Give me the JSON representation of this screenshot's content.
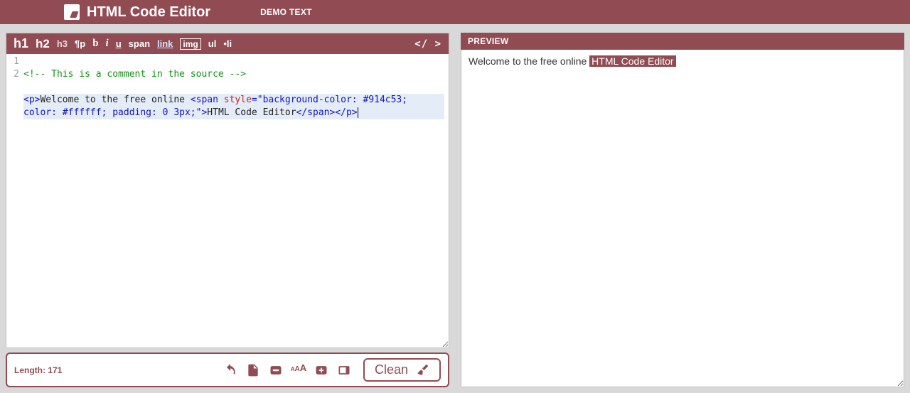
{
  "header": {
    "title": "HTML Code Editor",
    "demo_link": "DEMO TEXT"
  },
  "toolbar": {
    "h1": "h1",
    "h2": "h2",
    "h3": "h3",
    "para": "¶p",
    "bold": "b",
    "italic": "i",
    "underline": "u",
    "span": "span",
    "link": "link",
    "img": "img",
    "ul": "ul",
    "li": "•li",
    "close": "</ >"
  },
  "code": {
    "gutter": [
      "1",
      "2"
    ],
    "line1_comment": "<!-- This is a comment in the source -->",
    "line2": {
      "open_p": "<p>",
      "text1": "Welcome to the free online ",
      "open_span": "<span",
      "sp": " ",
      "attr": "style",
      "eq": "=\"",
      "style_val": "background-color: #914c53; color: #ffffff; padding: 0 3px;",
      "endq": "\">",
      "text2": "HTML Code Editor",
      "close_span": "</span>",
      "close_p": "</p>"
    }
  },
  "footer": {
    "length_label": "Length: 171",
    "clean_label": "Clean"
  },
  "preview": {
    "header": "PREVIEW",
    "text_plain": "Welcome to the free online ",
    "badge_text": "HTML Code Editor"
  }
}
